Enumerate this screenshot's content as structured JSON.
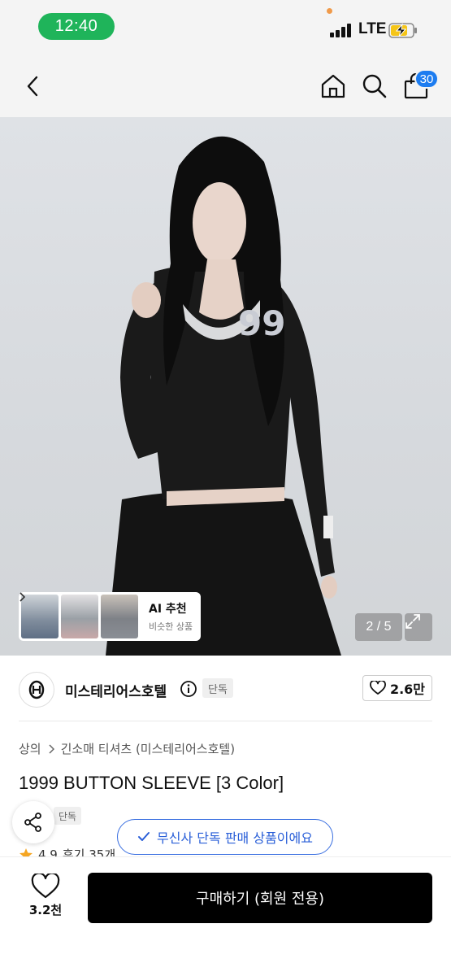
{
  "status": {
    "time": "12:40",
    "network": "LTE"
  },
  "nav": {
    "cart_count": "30"
  },
  "hero": {
    "page_indicator": "2 / 5",
    "ai_card": {
      "title": "AI 추천",
      "subtitle": "비슷한 상품"
    }
  },
  "brand": {
    "name": "미스테리어스호텔",
    "exclusive_tag": "단독",
    "likes": "2.6만"
  },
  "product": {
    "breadcrumb": [
      "상의",
      "긴소매 티셔츠 (미스테리어스호텔)"
    ],
    "title": "1999 BUTTON SLEEVE [3 Color]",
    "exclusive_tag": "단독",
    "rating": "4.9",
    "reviews": "후기 35개"
  },
  "toast": {
    "text": "무신사 단독 판매 상품이에요"
  },
  "bottom": {
    "wish_count": "3.2천",
    "buy_label": "구매하기 (회원 전용)"
  },
  "colors": {
    "accent_blue": "#1c7cf0",
    "status_green": "#1fb45a",
    "buy_button": "#000000"
  }
}
